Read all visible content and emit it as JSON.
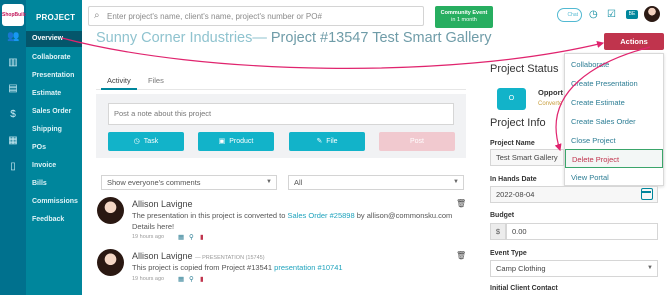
{
  "brand": {
    "logo_text": "ShopBuilder"
  },
  "rail_icons": [
    "users-icon",
    "bar-chart-icon",
    "report-icon",
    "dollar-icon",
    "building-icon",
    "book-icon"
  ],
  "nav": {
    "title": "PROJECT",
    "items": [
      {
        "label": "Overview",
        "active": true
      },
      {
        "label": "Collaborate"
      },
      {
        "label": "Presentation"
      },
      {
        "label": "Estimate"
      },
      {
        "label": "Sales Order"
      },
      {
        "label": "Shipping"
      },
      {
        "label": "POs"
      },
      {
        "label": "Invoice"
      },
      {
        "label": "Bills"
      },
      {
        "label": "Commissions"
      },
      {
        "label": "Feedback"
      }
    ]
  },
  "search": {
    "placeholder": "Enter project's name, client's name, project's number or PO#"
  },
  "community": {
    "title": "Community Event",
    "subtitle": "in 1 month"
  },
  "top": {
    "chat_label": "Chat",
    "badge": "BE"
  },
  "project": {
    "client": "Sunny Corner Industries",
    "separator": "— ",
    "number_text": "Project #13547 Test Smart Gallery"
  },
  "actions": {
    "label": "Actions",
    "menu": [
      "Collaborate",
      "Create Presentation",
      "Create Estimate",
      "Create Sales Order",
      "Close Project",
      "Delete Project",
      "View Portal"
    ],
    "highlighted": "Delete Project"
  },
  "tabs": [
    "Activity",
    "Files"
  ],
  "note": {
    "placeholder": "Post a note about this project",
    "buttons": [
      "Task",
      "Product",
      "File",
      "Post"
    ]
  },
  "filters": {
    "comments": "Show everyone's comments",
    "type": "All"
  },
  "feed": [
    {
      "name": "Allison Lavigne",
      "tag": "",
      "text_before": "The presentation in this project is converted to ",
      "link": "Sales Order #25898",
      "text_after": " by allison@commonsku.com",
      "line2": "Details here!",
      "time": "19 hours ago"
    },
    {
      "name": "Allison Lavigne",
      "tag": "— PRESENTATION (15745)",
      "text_before": "This project is copied from Project #13541 ",
      "link": "presentation #10741",
      "text_after": "",
      "line2": "",
      "time": "19 hours ago"
    }
  ],
  "status": {
    "heading": "Project Status",
    "stage_icon": "O",
    "stage_label": "Opport",
    "stage_sub": "Converte"
  },
  "info": {
    "heading": "Project Info",
    "project_name_label": "Project Name",
    "project_name_value": "Test Smart Gallery",
    "in_hands_label": "In Hands Date",
    "in_hands_value": "2022-08-04",
    "budget_label": "Budget",
    "budget_currency": "$",
    "budget_value": "0.00",
    "event_type_label": "Event Type",
    "event_type_value": "Camp Clothing",
    "initial_contact_label": "Initial Client Contact"
  },
  "colors": {
    "nav_bg": "#00869c",
    "rail_bg": "#00718e",
    "actions_bg": "#c0344d",
    "accent": "#12b3c9",
    "annotation": "#e0246e"
  }
}
